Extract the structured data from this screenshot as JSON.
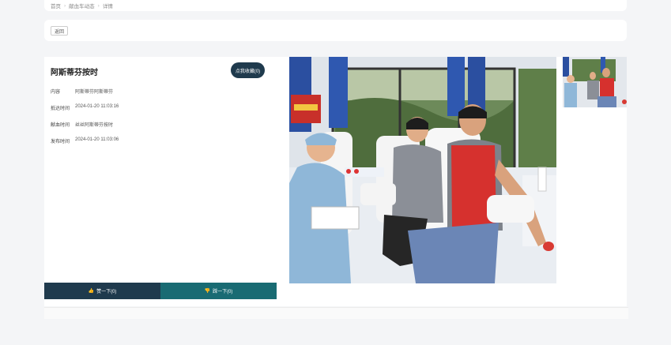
{
  "breadcrumb": {
    "home": "首页",
    "section": "献血车动态",
    "current": "详情"
  },
  "back_label": "返回",
  "detail": {
    "title": "阿斯蒂芬按时",
    "favorite_label": "点我收藏(0)",
    "fields": [
      {
        "label": "内容",
        "value": "阿斯蒂芬阿斯蒂芬"
      },
      {
        "label": "抵达时间",
        "value": "2024-01-20 11:03:16"
      },
      {
        "label": "献血时间",
        "value": "丝丝阿斯蒂芬按时"
      },
      {
        "label": "发布时间",
        "value": "2024-01-20 11:03:06"
      }
    ],
    "like_label": "赞一下(0)",
    "dislike_label": "踩一下(0)"
  },
  "colors": {
    "primary": "#1f3a4d",
    "secondary": "#196b73"
  },
  "icons": {
    "like": "thumbs-up-icon",
    "dislike": "thumbs-down-icon"
  }
}
